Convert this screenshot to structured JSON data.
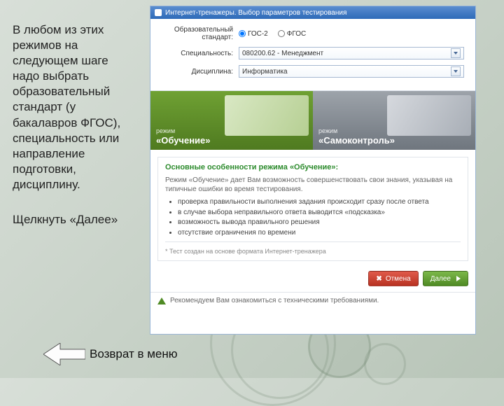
{
  "left_panel": {
    "para1": "В любом из этих режимов на следующем шаге надо выбрать образовательный стандарт (у бакалавров ФГОС), специальность или направление подготовки, дисциплину.",
    "para2": "Щелкнуть «Далее»",
    "back_label": "Возврат в меню"
  },
  "window": {
    "title": "Интернет-тренажеры. Выбор параметров тестирования",
    "form": {
      "standard_label": "Образовательный стандарт:",
      "radio_gos": "ГОС-2",
      "radio_fgos": "ФГОС",
      "specialty_label": "Специальность:",
      "specialty_value": "080200.62 - Менеджмент",
      "discipline_label": "Дисциплина:",
      "discipline_value": "Информатика"
    },
    "modes": {
      "caption": "режим",
      "learn": "«Обучение»",
      "self": "«Самоконтроль»"
    },
    "features": {
      "title": "Основные особенности режима «Обучение»:",
      "intro": "Режим «Обучение» дает Вам возможность совершенствовать свои знания, указывая на типичные ошибки во время тестирования.",
      "items": [
        "проверка правильности выполнения задания происходит сразу после ответа",
        "в случае выбора неправильного ответа выводится «подсказка»",
        "возможность вывода правильного решения",
        "отсутствие ограничения по времени"
      ],
      "footnote": "* Тест создан на основе формата Интернет-тренажера"
    },
    "buttons": {
      "cancel": "Отмена",
      "next": "Далее"
    },
    "tech_note": "Рекомендуем Вам ознакомиться с техническими требованиями."
  }
}
